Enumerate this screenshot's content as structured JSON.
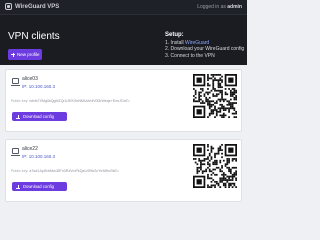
{
  "topbar": {
    "brand": "WireGuard VPS",
    "logged_in_prefix": "Logged in as ",
    "username": "admin"
  },
  "hero": {
    "title": "VPN clients",
    "new_profile_label": "New profile"
  },
  "setup": {
    "title": "Setup:",
    "step1_prefix": "1. Install ",
    "step1_link": "WireGuard",
    "step2": "2. Download your WireGuard config",
    "step3": "3. Connect to the VPN"
  },
  "clients": [
    {
      "name": "alice03",
      "ip_label": "IP:",
      "ip": "10.100.160.3",
      "pubkey_label": "Public key:",
      "pubkey": "wfcib7XMg0kQgMZQrUJEKXbNMUvie4V0l3rWeqs+EnnJCeE=",
      "download_label": "Download config"
    },
    {
      "name": "alice22",
      "ip_label": "IP:",
      "ip": "10.100.160.3",
      "pubkey_label": "Public key:",
      "pubkey": "a7sd1Jq4KxfMwJ8Fn3RzVmPkQeLt9HbZcYtr5WxGkE=",
      "download_label": "Download config"
    }
  ],
  "colors": {
    "accent": "#6c3ce0",
    "hero_bg": "#1a1c22",
    "link": "#4a56c4"
  },
  "icons": {
    "brand": "vpn-logo-icon",
    "new_profile": "plus-icon",
    "device": "laptop-icon",
    "download": "download-icon",
    "qr": "qr-code-icon"
  }
}
